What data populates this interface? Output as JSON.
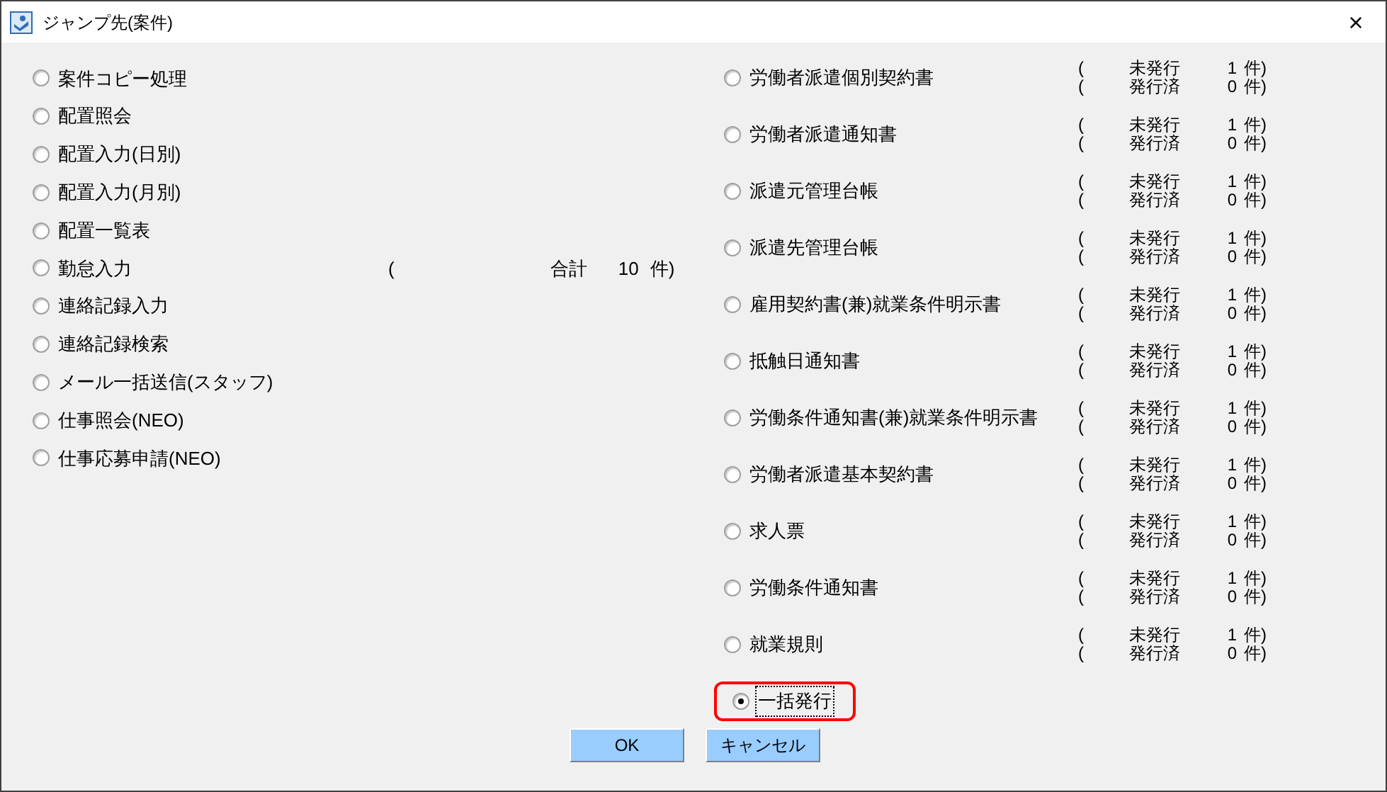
{
  "window": {
    "title": "ジャンプ先(案件)",
    "close": "×"
  },
  "left_options": [
    {
      "label": "案件コピー処理",
      "selected": false
    },
    {
      "label": "配置照会",
      "selected": false
    },
    {
      "label": "配置入力(日別)",
      "selected": false
    },
    {
      "label": "配置入力(月別)",
      "selected": false
    },
    {
      "label": "配置一覧表",
      "selected": false
    },
    {
      "label": "勤怠入力",
      "selected": false,
      "summary": {
        "open": "(",
        "label": "合計",
        "count": "10",
        "unit": "件)"
      }
    },
    {
      "label": "連絡記録入力",
      "selected": false
    },
    {
      "label": "連絡記録検索",
      "selected": false
    },
    {
      "label": "メール一括送信(スタッフ)",
      "selected": false
    },
    {
      "label": "仕事照会(NEO)",
      "selected": false
    },
    {
      "label": "仕事応募申請(NEO)",
      "selected": false
    }
  ],
  "documents": [
    {
      "label": "労働者派遣個別契約書",
      "selected": false,
      "lines": [
        {
          "open": "(",
          "status": "未発行",
          "count": "1",
          "unit": "件)"
        },
        {
          "open": "(",
          "status": "発行済",
          "count": "0",
          "unit": "件)"
        }
      ]
    },
    {
      "label": "労働者派遣通知書",
      "selected": false,
      "lines": [
        {
          "open": "(",
          "status": "未発行",
          "count": "1",
          "unit": "件)"
        },
        {
          "open": "(",
          "status": "発行済",
          "count": "0",
          "unit": "件)"
        }
      ]
    },
    {
      "label": "派遣元管理台帳",
      "selected": false,
      "lines": [
        {
          "open": "(",
          "status": "未発行",
          "count": "1",
          "unit": "件)"
        },
        {
          "open": "(",
          "status": "発行済",
          "count": "0",
          "unit": "件)"
        }
      ]
    },
    {
      "label": "派遣先管理台帳",
      "selected": false,
      "lines": [
        {
          "open": "(",
          "status": "未発行",
          "count": "1",
          "unit": "件)"
        },
        {
          "open": "(",
          "status": "発行済",
          "count": "0",
          "unit": "件)"
        }
      ]
    },
    {
      "label": "雇用契約書(兼)就業条件明示書",
      "selected": false,
      "lines": [
        {
          "open": "(",
          "status": "未発行",
          "count": "1",
          "unit": "件)"
        },
        {
          "open": "(",
          "status": "発行済",
          "count": "0",
          "unit": "件)"
        }
      ]
    },
    {
      "label": "抵触日通知書",
      "selected": false,
      "lines": [
        {
          "open": "(",
          "status": "未発行",
          "count": "1",
          "unit": "件)"
        },
        {
          "open": "(",
          "status": "発行済",
          "count": "0",
          "unit": "件)"
        }
      ]
    },
    {
      "label": "労働条件通知書(兼)就業条件明示書",
      "selected": false,
      "lines": [
        {
          "open": "(",
          "status": "未発行",
          "count": "1",
          "unit": "件)"
        },
        {
          "open": "(",
          "status": "発行済",
          "count": "0",
          "unit": "件)"
        }
      ]
    },
    {
      "label": "労働者派遣基本契約書",
      "selected": false,
      "lines": [
        {
          "open": "(",
          "status": "未発行",
          "count": "1",
          "unit": "件)"
        },
        {
          "open": "(",
          "status": "発行済",
          "count": "0",
          "unit": "件)"
        }
      ]
    },
    {
      "label": "求人票",
      "selected": false,
      "lines": [
        {
          "open": "(",
          "status": "未発行",
          "count": "1",
          "unit": "件)"
        },
        {
          "open": "(",
          "status": "発行済",
          "count": "0",
          "unit": "件)"
        }
      ]
    },
    {
      "label": "労働条件通知書",
      "selected": false,
      "lines": [
        {
          "open": "(",
          "status": "未発行",
          "count": "1",
          "unit": "件)"
        },
        {
          "open": "(",
          "status": "発行済",
          "count": "0",
          "unit": "件)"
        }
      ]
    },
    {
      "label": "就業規則",
      "selected": false,
      "lines": [
        {
          "open": "(",
          "status": "未発行",
          "count": "1",
          "unit": "件)"
        },
        {
          "open": "(",
          "status": "発行済",
          "count": "0",
          "unit": "件)"
        }
      ]
    }
  ],
  "bulk_option": {
    "label": "一括発行",
    "selected": true,
    "highlighted": true
  },
  "buttons": [
    {
      "label": "OK"
    },
    {
      "label": "キャンセル"
    }
  ]
}
